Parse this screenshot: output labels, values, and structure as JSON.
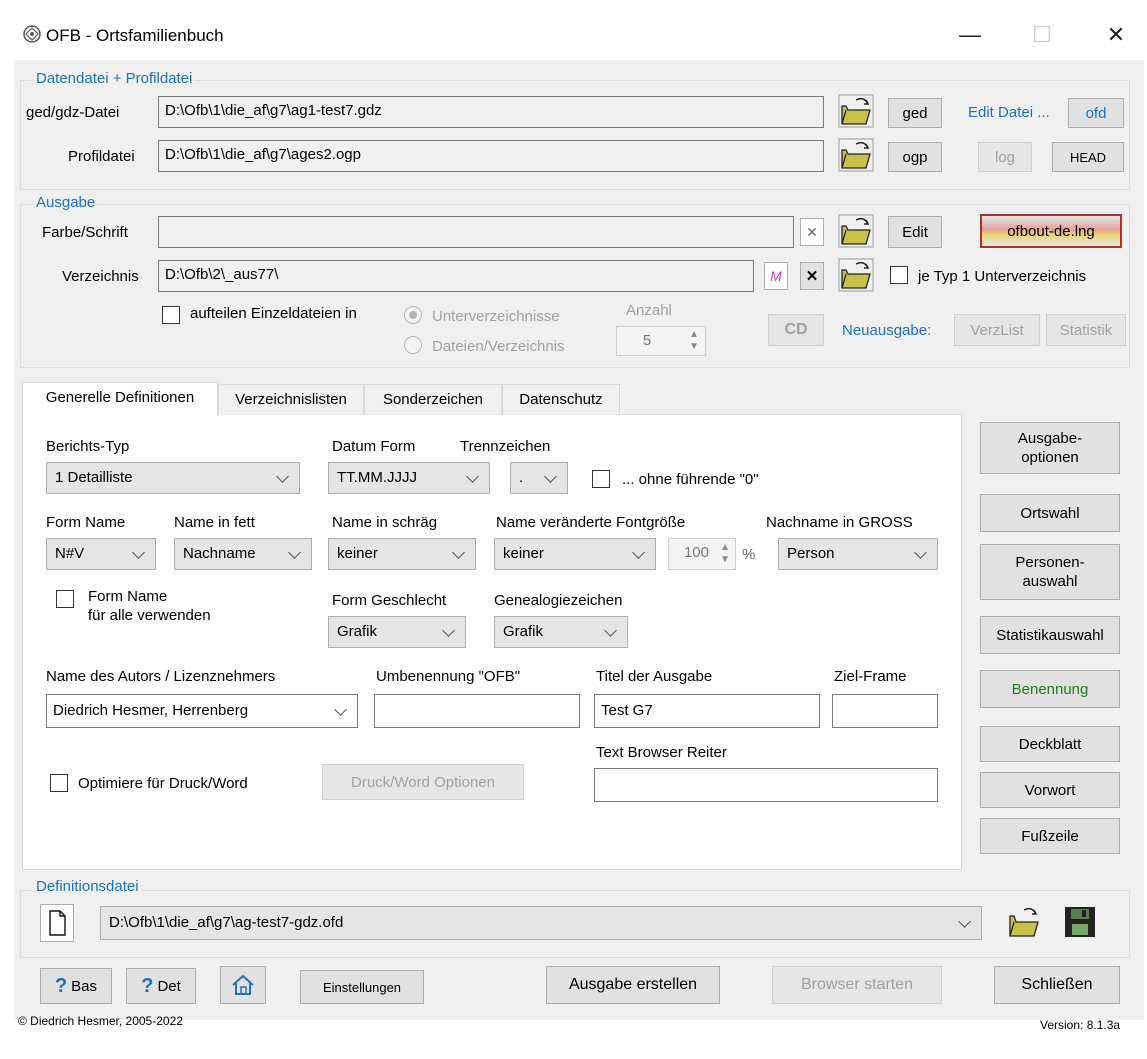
{
  "window": {
    "title": "OFB - Ortsfamilienbuch",
    "minimize": "—",
    "maximize": "☐",
    "close": "✕"
  },
  "datendatei": {
    "group_label": "Datendatei + Profildatei",
    "ged_label": "ged/gdz-Datei",
    "ged_value": "D:\\Ofb\\1\\die_af\\g7\\ag1-test7.gdz",
    "ged_button": "ged",
    "edit_datei_label": "Edit Datei ...",
    "ofd_button": "ofd",
    "profil_label": "Profildatei",
    "profil_value": "D:\\Ofb\\1\\die_af\\g7\\ages2.ogp",
    "ogp_button": "ogp",
    "log_button": "log",
    "head_button": "HEAD"
  },
  "ausgabe": {
    "group_label": "Ausgabe",
    "farbe_label": "Farbe/Schrift",
    "farbe_value": "",
    "clear_symbol": "✕",
    "edit_button": "Edit",
    "lng_button": "ofbout-de.lng",
    "verz_label": "Verzeichnis",
    "verz_value": "D:\\Ofb\\2\\_aus77\\",
    "m_button": "M",
    "x_button": "✕",
    "je_typ_label": "je Typ 1 Unterverzeichnis",
    "aufteilen_label": "aufteilen Einzeldateien in",
    "unterverzeichnisse_label": "Unterverzeichnisse",
    "dateien_label": "Dateien/Verzeichnis",
    "anzahl_label": "Anzahl",
    "anzahl_value": "5",
    "cd_button": "CD",
    "neuausgabe_label": "Neuausgabe:",
    "verzlist_button": "VerzList",
    "statistik_button": "Statistik"
  },
  "tabs": [
    {
      "label": "Generelle Definitionen"
    },
    {
      "label": "Verzeichnislisten"
    },
    {
      "label": "Sonderzeichen"
    },
    {
      "label": "Datenschutz"
    }
  ],
  "general": {
    "berichts_typ_label": "Berichts-Typ",
    "berichts_typ_value": "1 Detailliste",
    "datum_form_label": "Datum Form",
    "datum_form_value": "TT.MM.JJJJ",
    "trennzeichen_label": "Trennzeichen",
    "trennzeichen_value": ".",
    "ohne_fuehrende_label": "... ohne führende \"0\"",
    "form_name_label": "Form Name",
    "form_name_value": "N#V",
    "name_fett_label": "Name in fett",
    "name_fett_value": "Nachname",
    "name_schraeg_label": "Name in schräg",
    "name_schraeg_value": "keiner",
    "name_fontgroesse_label": "Name veränderte Fontgröße",
    "name_fontgroesse_value": "keiner",
    "font_percent_value": "100",
    "percent_symbol": "%",
    "nachname_gross_label": "Nachname in GROSS",
    "nachname_gross_value": "Person",
    "form_name_alle_line1": "Form Name",
    "form_name_alle_line2": "für alle verwenden",
    "form_geschlecht_label": "Form Geschlecht",
    "form_geschlecht_value": "Grafik",
    "genealogiezeichen_label": "Genealogiezeichen",
    "genealogiezeichen_value": "Grafik",
    "autor_label": "Name des Autors / Lizenznehmers",
    "autor_value": "Diedrich Hesmer, Herrenberg",
    "umbenennung_label": "Umbenennung \"OFB\"",
    "umbenennung_value": "",
    "titel_label": "Titel der Ausgabe",
    "titel_value": "Test G7",
    "ziel_frame_label": "Ziel-Frame",
    "ziel_frame_value": "",
    "text_browser_label": "Text Browser Reiter",
    "text_browser_value": "",
    "optimiere_label": "Optimiere für Druck/Word",
    "druck_optionen_button": "Druck/Word Optionen"
  },
  "side_buttons": {
    "ausgabe_optionen_1": "Ausgabe-",
    "ausgabe_optionen_2": "optionen",
    "ortswahl": "Ortswahl",
    "personen_1": "Personen-",
    "personen_2": "auswahl",
    "statistikauswahl": "Statistikauswahl",
    "benennung": "Benennung",
    "deckblatt": "Deckblatt",
    "vorwort": "Vorwort",
    "fusszeile": "Fußzeile",
    "benennung_color": "#1e7a1e"
  },
  "definitionsdatei": {
    "group_label": "Definitionsdatei",
    "value": "D:\\Ofb\\1\\die_af\\g7\\ag-test7-gdz.ofd"
  },
  "footer": {
    "bas_button": "Bas",
    "det_button": "Det",
    "help_symbol": "?",
    "einstellungen_button": "Einstellungen",
    "ausgabe_erstellen_button": "Ausgabe erstellen",
    "browser_starten_button": "Browser starten",
    "schliessen_button": "Schließen",
    "copyright": "© Diedrich Hesmer,  2005-2022",
    "version": "Version: 8.1.3a"
  }
}
